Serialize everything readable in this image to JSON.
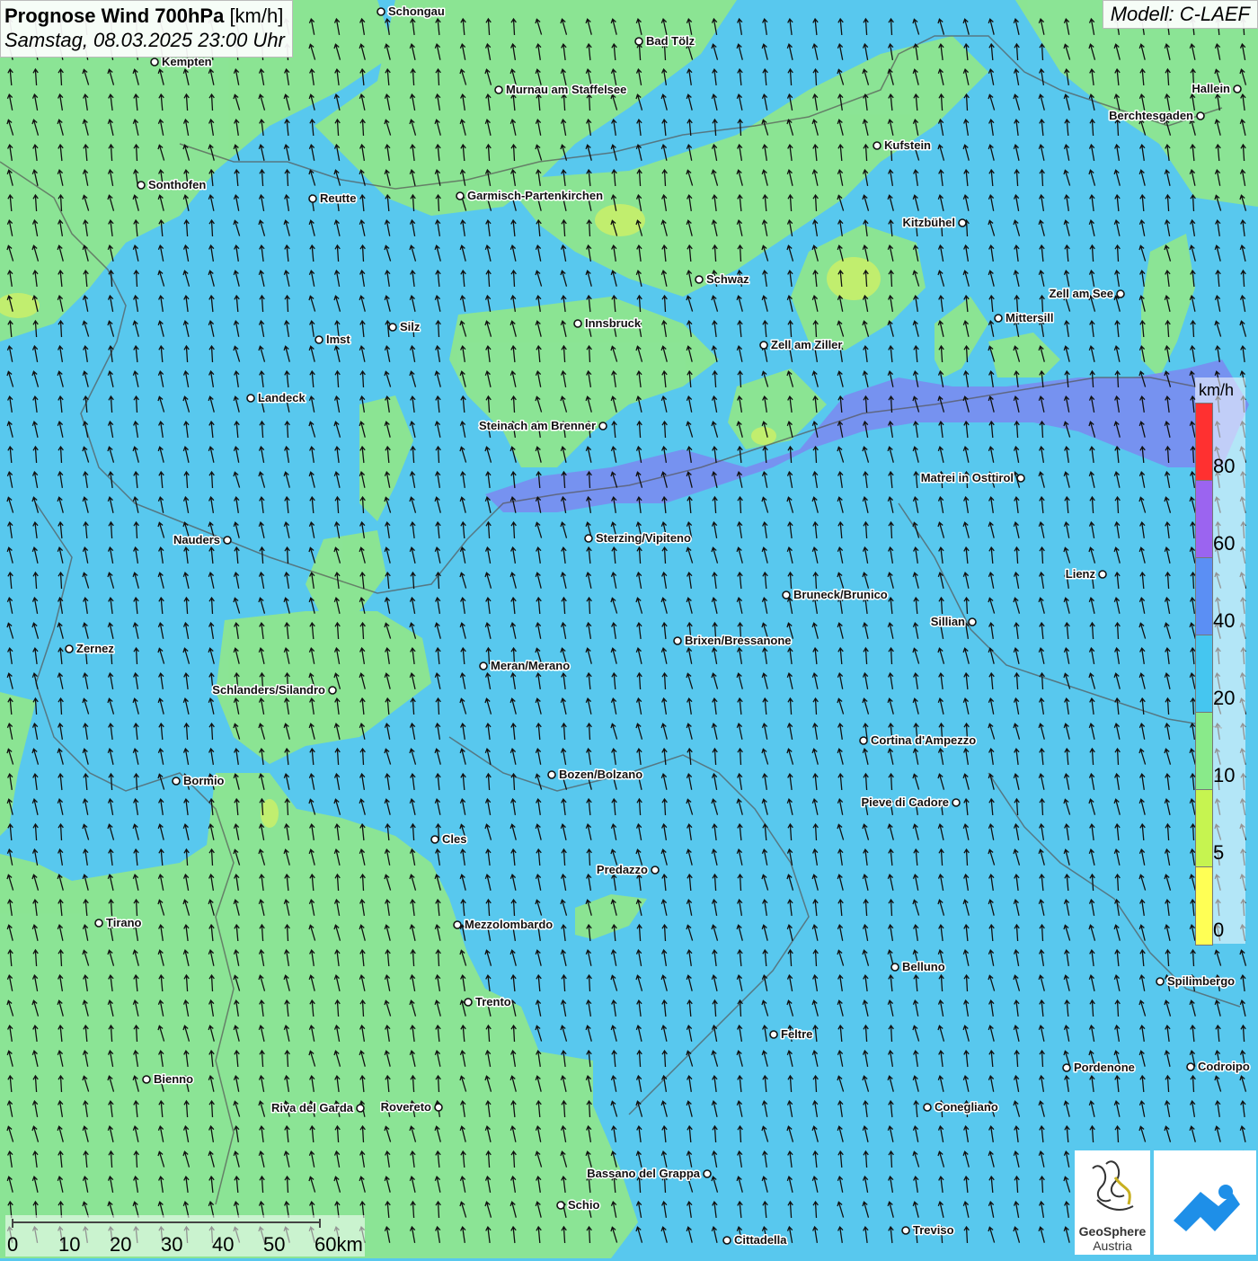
{
  "header": {
    "title_bold": "Prognose Wind 700hPa",
    "title_unit": "[km/h]",
    "subtitle": "Samstag, 08.03.2025 23:00 Uhr",
    "model": "Modell: C-LAEF"
  },
  "legend": {
    "unit": "km/h",
    "ticks": [
      "80",
      "60",
      "40",
      "20",
      "10",
      "5",
      "0"
    ],
    "colors": [
      "#ff3030",
      "#9b64f0",
      "#5b8ff4",
      "#45c6f0",
      "#89ea8a",
      "#c6f450",
      "#ffff55"
    ]
  },
  "scale": {
    "labels": [
      "0",
      "10",
      "20",
      "30",
      "40",
      "50",
      "60km"
    ]
  },
  "logos": {
    "geosphere_line1": "GeoSphere",
    "geosphere_line2": "Austria"
  },
  "cities": [
    {
      "name": "Schongau"
    },
    {
      "name": "Bad Tölz"
    },
    {
      "name": "Kempten"
    },
    {
      "name": "Murnau am Staffelsee"
    },
    {
      "name": "Hallein"
    },
    {
      "name": "Berchtesgaden"
    },
    {
      "name": "Kufstein"
    },
    {
      "name": "Sonthofen"
    },
    {
      "name": "Reutte"
    },
    {
      "name": "Garmisch-Partenkirchen"
    },
    {
      "name": "Kitzbühel"
    },
    {
      "name": "Schwaz"
    },
    {
      "name": "Zell am See"
    },
    {
      "name": "Mittersill"
    },
    {
      "name": "Innsbruck"
    },
    {
      "name": "Silz"
    },
    {
      "name": "Imst"
    },
    {
      "name": "Zell am Ziller"
    },
    {
      "name": "Landeck"
    },
    {
      "name": "Steinach am Brenner"
    },
    {
      "name": "Matrei in Osttirol"
    },
    {
      "name": "Nauders"
    },
    {
      "name": "Sterzing/Vipiteno"
    },
    {
      "name": "Lienz"
    },
    {
      "name": "Bruneck/Brunico"
    },
    {
      "name": "Sillian"
    },
    {
      "name": "Zernez"
    },
    {
      "name": "Brixen/Bressanone"
    },
    {
      "name": "Meran/Merano"
    },
    {
      "name": "Schlanders/Silandro"
    },
    {
      "name": "Cortina d'Ampezzo"
    },
    {
      "name": "Bozen/Bolzano"
    },
    {
      "name": "Bormio"
    },
    {
      "name": "Pieve di Cadore"
    },
    {
      "name": "Cles"
    },
    {
      "name": "Predazzo"
    },
    {
      "name": "Tirano"
    },
    {
      "name": "Mezzolombardo"
    },
    {
      "name": "Belluno"
    },
    {
      "name": "Spilimbergo"
    },
    {
      "name": "Trento"
    },
    {
      "name": "Feltre"
    },
    {
      "name": "Pordenone"
    },
    {
      "name": "Codroipo"
    },
    {
      "name": "Bienno"
    },
    {
      "name": "Riva del Garda"
    },
    {
      "name": "Rovereto"
    },
    {
      "name": "Conegliano"
    },
    {
      "name": "Bassano del Grappa"
    },
    {
      "name": "Schio"
    },
    {
      "name": "Treviso"
    },
    {
      "name": "Cittadella"
    }
  ]
}
